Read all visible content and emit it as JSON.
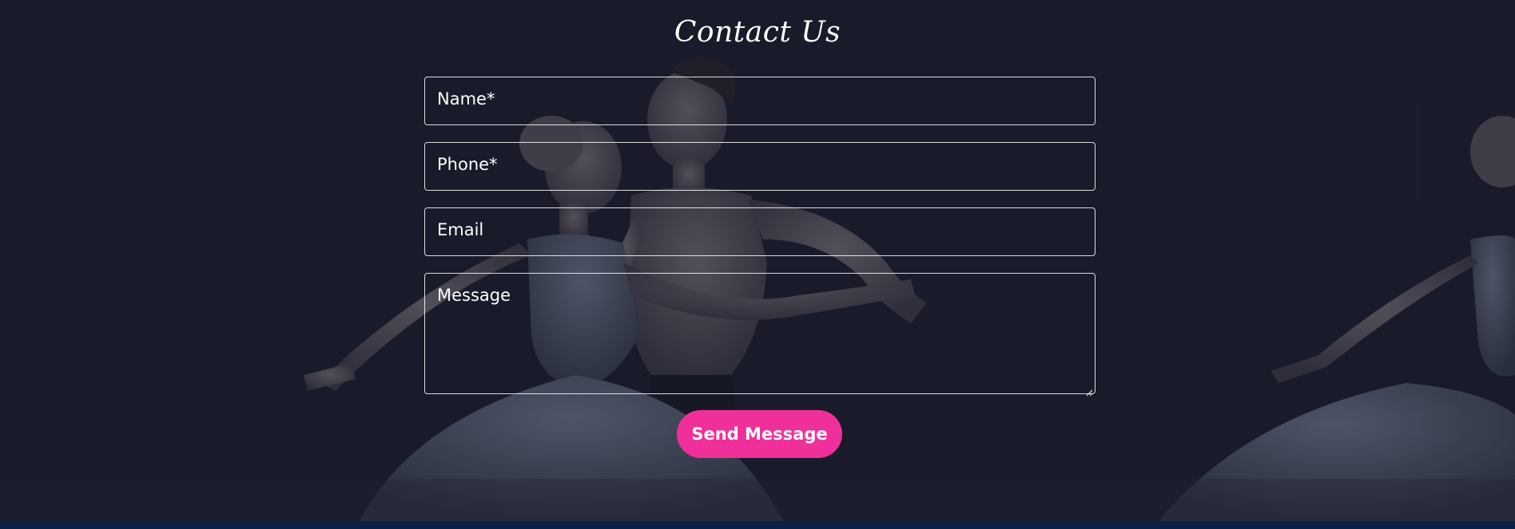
{
  "contact": {
    "title": "Contact Us",
    "fields": {
      "name_placeholder": "Name*",
      "phone_placeholder": "Phone*",
      "email_placeholder": "Email",
      "message_placeholder": "Message"
    },
    "send_label": "Send Message"
  },
  "colors": {
    "background": "#191c2a",
    "button": "#f0309a",
    "footer": "#0b2147",
    "text": "#ffffff"
  },
  "background_image": "ballet-dancers-photo"
}
